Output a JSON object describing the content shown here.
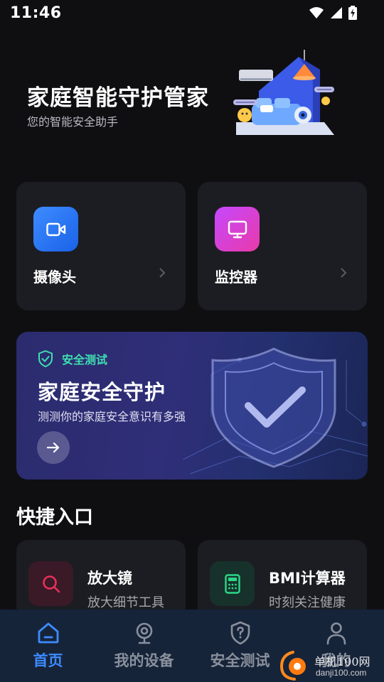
{
  "status_bar": {
    "time": "11:46"
  },
  "header": {
    "title": "家庭智能守护管家",
    "subtitle": "您的智能安全助手"
  },
  "devices": [
    {
      "label": "摄像头",
      "icon": "video-camera-icon",
      "color": "#2a78f5"
    },
    {
      "label": "监控器",
      "icon": "monitor-icon",
      "color": "#d63fd6"
    }
  ],
  "banner": {
    "tag": "安全测试",
    "title": "家庭安全守护",
    "subtitle": "测测你的家庭安全意识有多强",
    "tag_color": "#3ee0b0"
  },
  "quick_entry": {
    "title": "快捷入口",
    "items": [
      {
        "title": "放大镜",
        "desc": "放大细节工具",
        "icon": "search-icon",
        "color": "#e8305a"
      },
      {
        "title": "BMI计算器",
        "desc": "时刻关注健康",
        "icon": "calculator-icon",
        "color": "#2bd68a"
      }
    ]
  },
  "bottom_nav": {
    "items": [
      {
        "label": "首页",
        "icon": "home-icon",
        "active": true
      },
      {
        "label": "我的设备",
        "icon": "webcam-icon",
        "active": false
      },
      {
        "label": "安全测试",
        "icon": "shield-question-icon",
        "active": false
      },
      {
        "label": "我的",
        "icon": "user-icon",
        "active": false
      }
    ],
    "active_color": "#3d8bff"
  },
  "watermark": {
    "text": "单机100网",
    "url": "danji100.com"
  }
}
